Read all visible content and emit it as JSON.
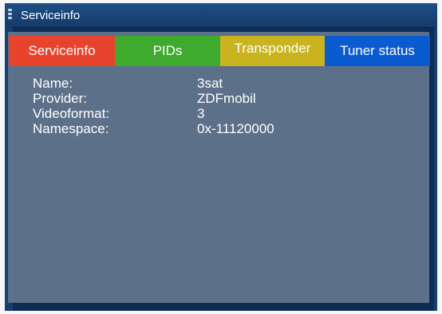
{
  "window": {
    "title": "Serviceinfo"
  },
  "tabs": [
    {
      "label": "Serviceinfo",
      "color": "#e8442d"
    },
    {
      "label": "PIDs",
      "color": "#3eaa2e"
    },
    {
      "label": "Transponder",
      "color": "#c9b41f"
    },
    {
      "label": "Tuner status",
      "color": "#0a5bd0"
    }
  ],
  "info": [
    {
      "label": "Name:",
      "value": "3sat"
    },
    {
      "label": "Provider:",
      "value": "ZDFmobil"
    },
    {
      "label": "Videoformat:",
      "value": "3"
    },
    {
      "label": "Namespace:",
      "value": "0x-11120000"
    }
  ]
}
